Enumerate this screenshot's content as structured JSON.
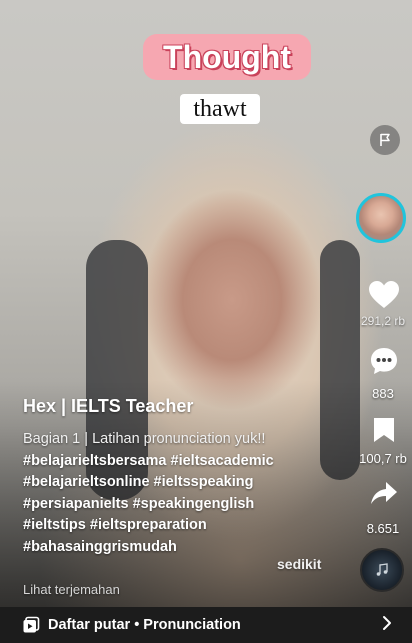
{
  "overlay": {
    "word": "Thought",
    "phonetic": "thawt"
  },
  "actions": {
    "likes": "291,2 rb",
    "comments": "883",
    "saves": "100,7 rb",
    "shares": "8.651"
  },
  "caption": {
    "author": "Hex | IELTS Teacher",
    "line1": "Bagian 1 | Latihan pronunciation yuk!!",
    "tags": [
      "#belajarieltsbersama #ieltsacademic",
      "#belajarieltsonline #ieltsspeaking",
      "#persiapanielts #speakingenglish",
      "#ieltstips #ieltspreparation",
      "#bahasainggrismudah"
    ],
    "more_label": "sedikit",
    "translate_label": "Lihat terjemahan"
  },
  "playlist": {
    "label": "Daftar putar • Pronunciation"
  },
  "icons": {
    "report": "flag-icon",
    "like": "heart-icon",
    "comment": "comment-icon",
    "save": "bookmark-icon",
    "share": "share-icon",
    "playlist": "playlist-icon",
    "arrow": "chevron-right-icon"
  }
}
